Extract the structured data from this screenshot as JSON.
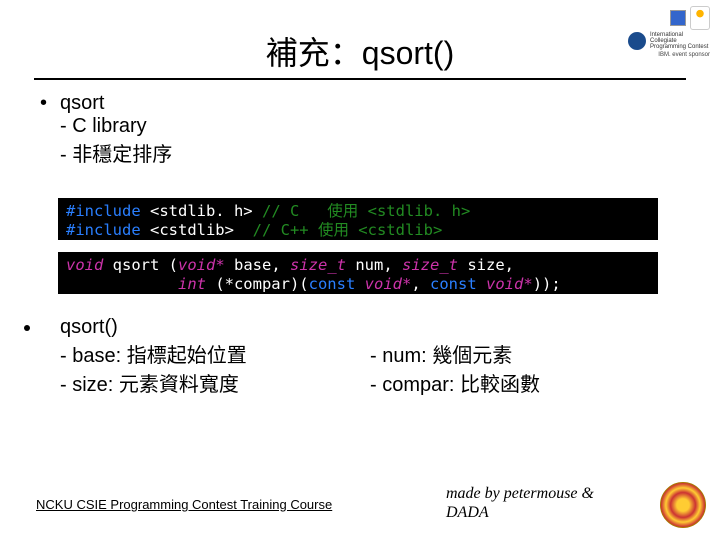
{
  "title": "補充：qsort()",
  "logos": {
    "acm_text": "International Collegiate Programming Contest",
    "ibm_text": "IBM. event sponsor"
  },
  "section1": {
    "bullet": "qsort",
    "sub1": "- C library",
    "sub2": "- 非穩定排序"
  },
  "code1": {
    "inc": "#include",
    "l1a": " <stdlib. h> ",
    "l1c": "// C   使用 <stdlib. h>",
    "l2a": " <cstdlib>  ",
    "l2c": "// C++ 使用 <cstdlib>"
  },
  "code2": {
    "kw_void": "void",
    "kw_qsort": " qsort ",
    "open": "(",
    "kw_voidp": "void*",
    "p1": " base, ",
    "kw_sizet": "size_t",
    "p2": " num, ",
    "p3": " size,",
    "line2_pad": "            ",
    "kw_int": "int",
    "fn": " (*compar)(",
    "kw_const": "const",
    "sp": " ",
    "end": "));",
    "comma": ", "
  },
  "section2": {
    "bullet": "qsort()",
    "base": "- base: 指標起始位置",
    "size": "- size: 元素資料寬度",
    "num": "- num: 幾個元素",
    "compar": "- compar: 比較函數"
  },
  "footer": {
    "left": "NCKU CSIE Programming Contest Training Course",
    "right1": "made by petermouse &",
    "right2": "DADA"
  }
}
